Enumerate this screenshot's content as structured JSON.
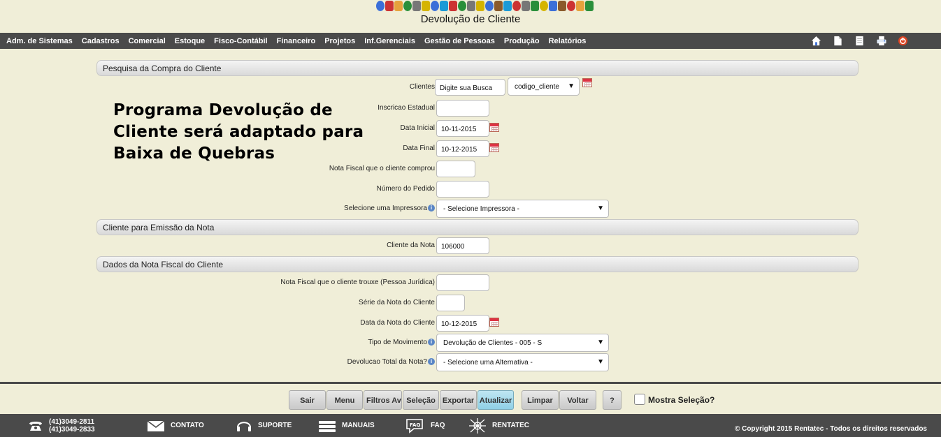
{
  "header": {
    "title": "Devolução de Cliente",
    "icon_colors": [
      "#3b6fd8",
      "#c33",
      "#e6a23c",
      "#2a8f3a",
      "#777",
      "#d5b400",
      "#3b6fd8",
      "#1b9ad6",
      "#c33",
      "#2a8f3a",
      "#777",
      "#d5b400",
      "#3b6fd8",
      "#8a5a2b",
      "#1b9ad6",
      "#c33",
      "#777",
      "#2a8f3a",
      "#d5b400",
      "#3b6fd8",
      "#8a5a2b",
      "#c33",
      "#e6a23c",
      "#2a8f3a"
    ]
  },
  "menu": {
    "items": [
      "Adm. de Sistemas",
      "Cadastros",
      "Comercial",
      "Estoque",
      "Fisco-Contábil",
      "Financeiro",
      "Projetos",
      "Inf.Gerenciais",
      "Gestão de Pessoas",
      "Produção",
      "Relatórios"
    ]
  },
  "sections": {
    "compra": "Pesquisa da Compra do Cliente",
    "emissao": "Cliente para Emissão da Nota",
    "dados": "Dados da Nota Fiscal do Cliente"
  },
  "form": {
    "clientes_label": "Clientes",
    "clientes_value": "Digite sua Busca",
    "clientes_field_select": "codigo_cliente",
    "ie_label": "Inscricao Estadual",
    "ie_value": "",
    "data_inicial_label": "Data Inicial",
    "data_inicial_value": "10-11-2015",
    "data_final_label": "Data Final",
    "data_final_value": "10-12-2015",
    "nf_comprou_label": "Nota Fiscal que o cliente comprou",
    "nf_comprou_value": "",
    "pedido_label": "Número do Pedido",
    "pedido_value": "",
    "impressora_label": "Selecione uma Impressora",
    "impressora_value": "- Selecione Impressora -",
    "cliente_nota_label": "Cliente da Nota",
    "cliente_nota_value": "106000",
    "nf_trouxe_label": "Nota Fiscal que o cliente trouxe (Pessoa Jurídica)",
    "nf_trouxe_value": "",
    "serie_label": "Série da Nota do Cliente",
    "serie_value": "",
    "data_nota_label": "Data da Nota do Cliente",
    "data_nota_value": "10-12-2015",
    "tipo_mov_label": "Tipo de Movimento",
    "tipo_mov_value": "Devolução de Clientes - 005 - S",
    "devolucao_total_label": "Devolucao Total da Nota?",
    "devolucao_total_value": "- Selecione uma Alternativa -",
    "info_glyph": "i",
    "arrow_glyph": "▼"
  },
  "note": {
    "line1": "Programa Devolução de",
    "line2": "Cliente será adaptado para",
    "line3": "Baixa de Quebras"
  },
  "toolbar": {
    "sair": "Sair",
    "menu": "Menu",
    "filtros": "Filtros Avançados",
    "selecao": "Seleção",
    "exportar": "Exportar",
    "atualizar": "Atualizar",
    "limpar": "Limpar",
    "voltar": "Voltar",
    "help": "?",
    "mostra_selecao": "Mostra Seleção?"
  },
  "footer": {
    "phone1": "(41)3049-2811",
    "phone2": "(41)3049-2833",
    "contato": "CONTATO",
    "suporte": "SUPORTE",
    "manuais": "MANUAIS",
    "faq": "FAQ",
    "rentatec": "RENTATEC",
    "copyright": "© Copyright 2015 Rentatec - Todos os direitos reservados"
  }
}
